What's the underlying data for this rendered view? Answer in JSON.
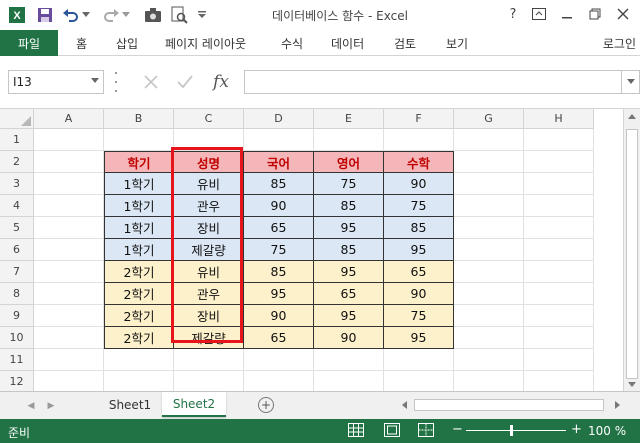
{
  "app": {
    "title": "데이터베이스 함수 - Excel"
  },
  "quick_access": {
    "icons": [
      "excel-logo-icon",
      "save-icon",
      "undo-icon",
      "undo-dropdown-icon",
      "redo-icon",
      "redo-dropdown-icon",
      "camera-icon",
      "print-preview-icon",
      "customize-qat-icon"
    ]
  },
  "window_controls": {
    "help": "?"
  },
  "ribbon": {
    "file": "파일",
    "tabs": [
      "홈",
      "삽입",
      "페이지 레이아웃",
      "수식",
      "데이터",
      "검토",
      "보기"
    ],
    "login": "로그인"
  },
  "formula_bar": {
    "name_box": "I13",
    "fx": "fx",
    "content": ""
  },
  "grid": {
    "columns": [
      "A",
      "B",
      "C",
      "D",
      "E",
      "F",
      "G",
      "H"
    ],
    "rows": [
      "1",
      "2",
      "3",
      "4",
      "5",
      "6",
      "7",
      "8",
      "9",
      "10",
      "11",
      "12"
    ],
    "header": [
      "학기",
      "성명",
      "국어",
      "영어",
      "수학"
    ],
    "data": [
      [
        "1학기",
        "유비",
        "85",
        "75",
        "90"
      ],
      [
        "1학기",
        "관우",
        "90",
        "85",
        "75"
      ],
      [
        "1학기",
        "장비",
        "65",
        "95",
        "85"
      ],
      [
        "1학기",
        "제갈량",
        "75",
        "85",
        "95"
      ],
      [
        "2학기",
        "유비",
        "85",
        "95",
        "65"
      ],
      [
        "2학기",
        "관우",
        "95",
        "65",
        "90"
      ],
      [
        "2학기",
        "장비",
        "90",
        "95",
        "75"
      ],
      [
        "2학기",
        "제갈량",
        "65",
        "90",
        "95"
      ]
    ],
    "colors": {
      "header_fill": "#f4b6b8",
      "header_text": "#c00000",
      "semester1_fill": "#dbe7f4",
      "semester2_fill": "#fdf1cc",
      "highlight_border": "#e8141c"
    }
  },
  "sheets": {
    "tabs": [
      "Sheet1",
      "Sheet2"
    ],
    "active": "Sheet2"
  },
  "status": {
    "text": "준비",
    "zoom": "100 %",
    "accent": "#217346"
  }
}
